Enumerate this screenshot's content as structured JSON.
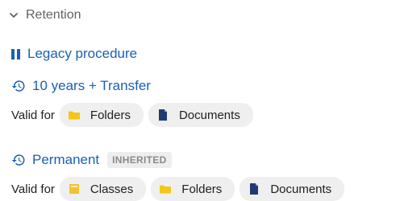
{
  "section": {
    "label": "Retention"
  },
  "rules": [
    {
      "icon": "pause-icon",
      "label": "Legacy procedure"
    },
    {
      "icon": "history-icon",
      "label": "10 years + Transfer",
      "valid_for_label": "Valid for",
      "targets": [
        {
          "icon": "folder-icon",
          "label": "Folders"
        },
        {
          "icon": "document-icon",
          "label": "Documents"
        }
      ]
    },
    {
      "icon": "history-icon",
      "label": "Permanent",
      "badge": "INHERITED",
      "valid_for_label": "Valid for",
      "targets": [
        {
          "icon": "class-icon",
          "label": "Classes"
        },
        {
          "icon": "folder-icon",
          "label": "Folders"
        },
        {
          "icon": "document-icon",
          "label": "Documents"
        }
      ]
    }
  ],
  "colors": {
    "link_blue": "#1a5fb4",
    "folder_yellow": "#f5c518",
    "class_yellow": "#f2c230",
    "document_navy": "#1f3b73",
    "chip_bg": "#efefef"
  }
}
